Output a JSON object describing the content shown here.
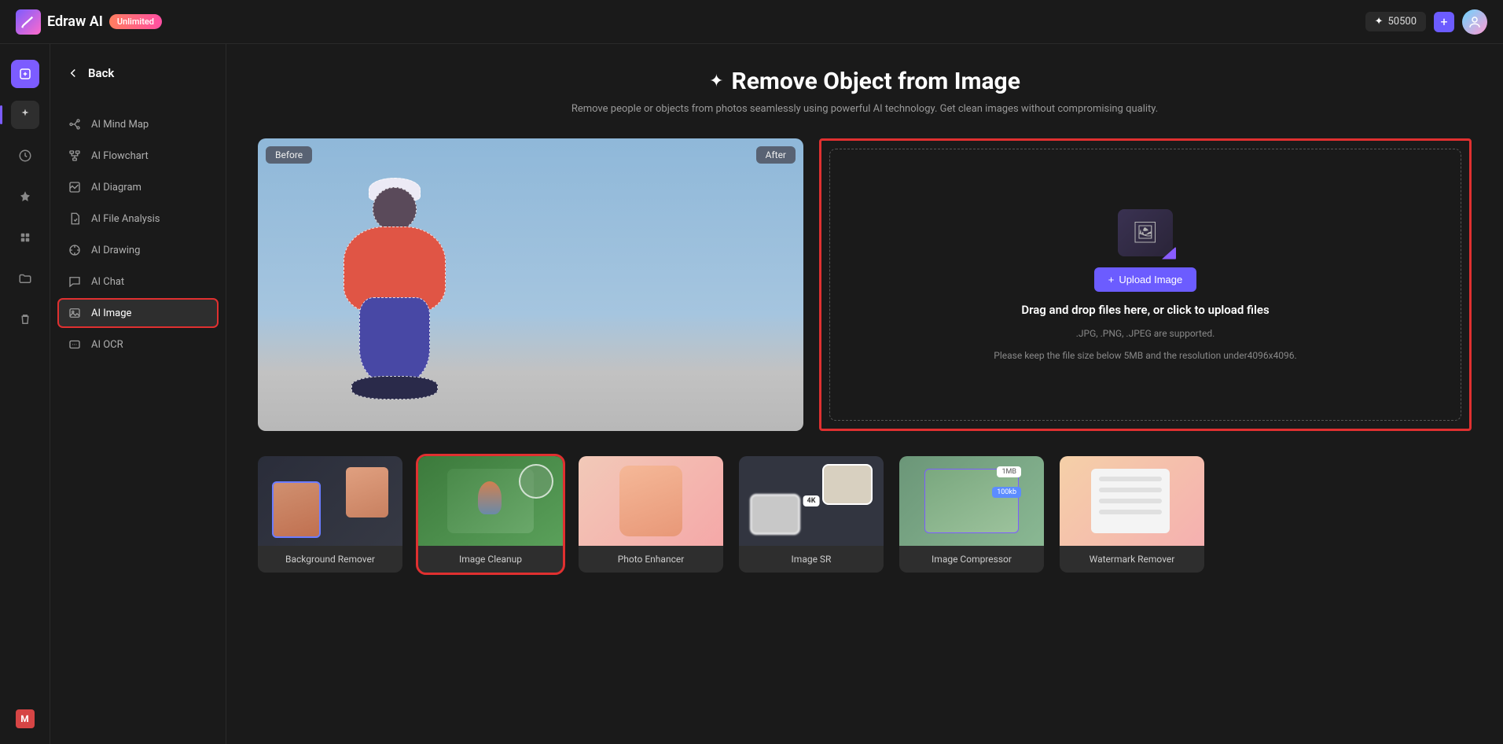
{
  "brand": {
    "name": "Edraw AI",
    "badge": "Unlimited"
  },
  "topbar": {
    "credits": "50500"
  },
  "sidebar": {
    "back": "Back",
    "items": [
      {
        "label": "AI Mind Map"
      },
      {
        "label": "AI Flowchart"
      },
      {
        "label": "AI Diagram"
      },
      {
        "label": "AI File Analysis"
      },
      {
        "label": "AI Drawing"
      },
      {
        "label": "AI Chat"
      },
      {
        "label": "AI Image"
      },
      {
        "label": "AI OCR"
      }
    ]
  },
  "page": {
    "title": "Remove Object from Image",
    "subtitle": "Remove people or objects from photos seamlessly using powerful AI technology. Get clean images without compromising quality."
  },
  "preview": {
    "before": "Before",
    "after": "After"
  },
  "upload": {
    "button": "Upload Image",
    "headline": "Drag and drop files here, or click to upload files",
    "formats": ".JPG, .PNG, .JPEG are supported.",
    "limits": "Please keep the file size below 5MB and the resolution under4096x4096."
  },
  "tools": [
    {
      "label": "Background Remover"
    },
    {
      "label": "Image Cleanup"
    },
    {
      "label": "Photo Enhancer"
    },
    {
      "label": "Image SR"
    },
    {
      "label": "Image Compressor"
    },
    {
      "label": "Watermark Remover"
    }
  ],
  "thumbs": {
    "sr_4k": "4K",
    "compress_1mb": "1MB",
    "compress_100kb": "100kb"
  },
  "rail_bottom": "M"
}
